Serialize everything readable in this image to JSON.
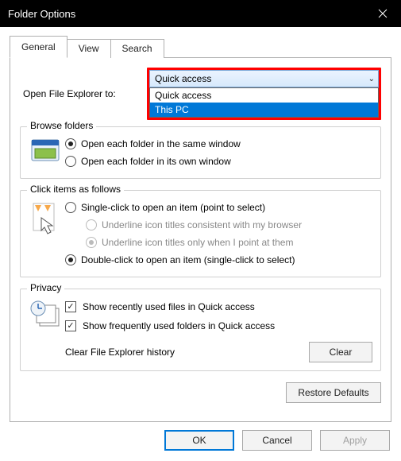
{
  "title": "Folder Options",
  "tabs": {
    "general": "General",
    "view": "View",
    "search": "Search"
  },
  "open_row": {
    "label": "Open File Explorer to:",
    "selected": "Quick access",
    "options": [
      "Quick access",
      "This PC"
    ]
  },
  "browse": {
    "title": "Browse folders",
    "same": "Open each folder in the same window",
    "own": "Open each folder in its own window"
  },
  "click": {
    "title": "Click items as follows",
    "single": "Single-click to open an item (point to select)",
    "ul_browser": "Underline icon titles consistent with my browser",
    "ul_point": "Underline icon titles only when I point at them",
    "double": "Double-click to open an item (single-click to select)"
  },
  "privacy": {
    "title": "Privacy",
    "recent": "Show recently used files in Quick access",
    "frequent": "Show frequently used folders in Quick access",
    "clear_label": "Clear File Explorer history",
    "clear_btn": "Clear"
  },
  "restore": "Restore Defaults",
  "buttons": {
    "ok": "OK",
    "cancel": "Cancel",
    "apply": "Apply"
  }
}
